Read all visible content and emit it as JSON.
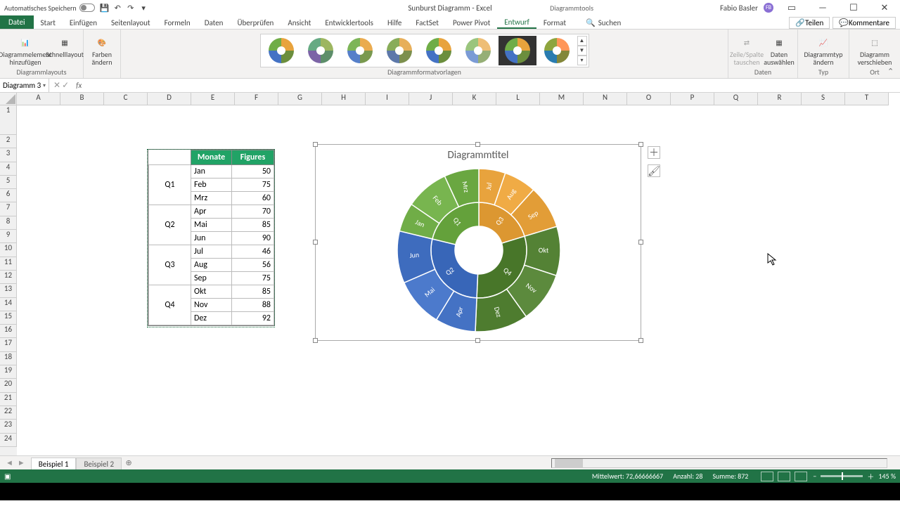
{
  "titlebar": {
    "autosave_label": "Automatisches Speichern",
    "doc_title": "Sunburst Diagramm - Excel",
    "context_tool": "Diagrammtools",
    "user_name": "Fabio Basler",
    "user_initials": "FB"
  },
  "ribbon": {
    "file": "Datei",
    "tabs": [
      "Start",
      "Einfügen",
      "Seitenlayout",
      "Formeln",
      "Daten",
      "Überprüfen",
      "Ansicht",
      "Entwicklertools",
      "Hilfe",
      "FactSet",
      "Power Pivot",
      "Entwurf",
      "Format"
    ],
    "active_tab": "Entwurf",
    "tell_me": "Suchen",
    "share": "Teilen",
    "comments": "Kommentare",
    "groups": {
      "layouts": {
        "add": "Diagrammelement hinzufügen",
        "quick": "Schnelllayout",
        "colors": "Farben ändern",
        "label": "Diagrammlayouts"
      },
      "styles": {
        "label": "Diagrammformatvorlagen"
      },
      "data": {
        "switch": "Zeile/Spalte tauschen",
        "select": "Daten auswählen",
        "label": "Daten"
      },
      "type": {
        "change": "Diagrammtyp ändern",
        "label": "Typ"
      },
      "location": {
        "move": "Diagramm verschieben",
        "label": "Ort"
      }
    }
  },
  "namebox": "Diagramm 3",
  "columns": [
    "A",
    "B",
    "C",
    "D",
    "E",
    "F",
    "G",
    "H",
    "I",
    "J",
    "K",
    "L",
    "M",
    "N",
    "O",
    "P",
    "Q",
    "R",
    "S",
    "T"
  ],
  "row_headers": [
    "1",
    "2",
    "3",
    "4",
    "5",
    "6",
    "7",
    "8",
    "9",
    "10",
    "11",
    "12",
    "13",
    "14",
    "15",
    "16",
    "17",
    "18",
    "19",
    "20",
    "21",
    "22",
    "23",
    "24"
  ],
  "table": {
    "headers": {
      "monate": "Monate",
      "figures": "Figures"
    },
    "quarters": [
      {
        "q": "Q1",
        "rows": [
          [
            "Jan",
            "50"
          ],
          [
            "Feb",
            "75"
          ],
          [
            "Mrz",
            "60"
          ]
        ]
      },
      {
        "q": "Q2",
        "rows": [
          [
            "Apr",
            "70"
          ],
          [
            "Mai",
            "85"
          ],
          [
            "Jun",
            "90"
          ]
        ]
      },
      {
        "q": "Q3",
        "rows": [
          [
            "Jul",
            "46"
          ],
          [
            "Aug",
            "56"
          ],
          [
            "Sep",
            "75"
          ]
        ]
      },
      {
        "q": "Q4",
        "rows": [
          [
            "Okt",
            "85"
          ],
          [
            "Nov",
            "88"
          ],
          [
            "Dez",
            "92"
          ]
        ]
      }
    ]
  },
  "chart": {
    "title": "Diagrammtitel"
  },
  "chart_data": {
    "type": "sunburst",
    "title": "Diagrammtitel",
    "inner_ring": [
      "Q1",
      "Q2",
      "Q3",
      "Q4"
    ],
    "outer_ring": {
      "Q1": [
        [
          "Jan",
          50
        ],
        [
          "Feb",
          75
        ],
        [
          "Mrz",
          60
        ]
      ],
      "Q2": [
        [
          "Apr",
          70
        ],
        [
          "Mai",
          85
        ],
        [
          "Jun",
          90
        ]
      ],
      "Q3": [
        [
          "Jul",
          46
        ],
        [
          "Aug",
          56
        ],
        [
          "Sep",
          75
        ]
      ],
      "Q4": [
        [
          "Okt",
          85
        ],
        [
          "Nov",
          88
        ],
        [
          "Dez",
          92
        ]
      ]
    },
    "colors": {
      "Q1": "#70ad47",
      "Q2": "#4472c4",
      "Q3": "#e8a33d",
      "Q4": "#548235"
    }
  },
  "sheets": {
    "active": "Beispiel 1",
    "others": [
      "Beispiel 2"
    ]
  },
  "statusbar": {
    "mean": "Mittelwert: 72,66666667",
    "count": "Anzahl: 28",
    "sum": "Summe: 872",
    "zoom": "145 %"
  }
}
